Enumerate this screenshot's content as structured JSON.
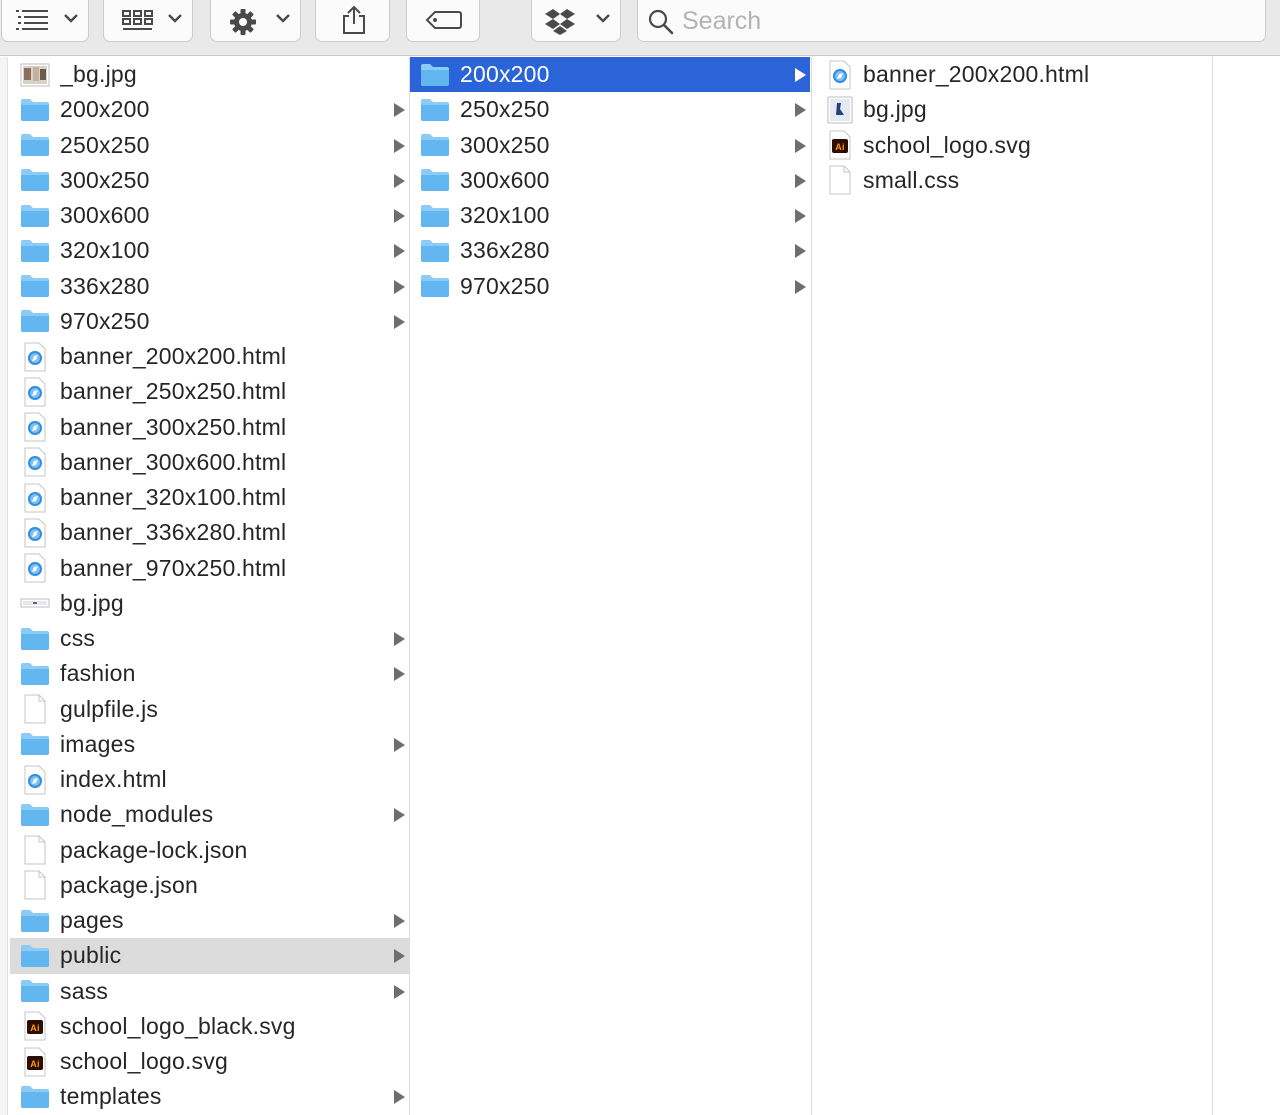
{
  "toolbar": {
    "search_placeholder": "Search",
    "search_value": ""
  },
  "colors": {
    "selection_blue": "#2b64d9",
    "selection_gray": "#dcdcdc",
    "folder_blue": "#62b7f0"
  },
  "column1": {
    "items": [
      {
        "name": "_bg.jpg",
        "type": "image-thumb",
        "folder": false
      },
      {
        "name": "200x200",
        "type": "folder",
        "folder": true
      },
      {
        "name": "250x250",
        "type": "folder",
        "folder": true
      },
      {
        "name": "300x250",
        "type": "folder",
        "folder": true
      },
      {
        "name": "300x600",
        "type": "folder",
        "folder": true
      },
      {
        "name": "320x100",
        "type": "folder",
        "folder": true
      },
      {
        "name": "336x280",
        "type": "folder",
        "folder": true
      },
      {
        "name": "970x250",
        "type": "folder",
        "folder": true
      },
      {
        "name": "banner_200x200.html",
        "type": "html",
        "folder": false
      },
      {
        "name": "banner_250x250.html",
        "type": "html",
        "folder": false
      },
      {
        "name": "banner_300x250.html",
        "type": "html",
        "folder": false
      },
      {
        "name": "banner_300x600.html",
        "type": "html",
        "folder": false
      },
      {
        "name": "banner_320x100.html",
        "type": "html",
        "folder": false
      },
      {
        "name": "banner_336x280.html",
        "type": "html",
        "folder": false
      },
      {
        "name": "banner_970x250.html",
        "type": "html",
        "folder": false
      },
      {
        "name": "bg.jpg",
        "type": "image-strip",
        "folder": false
      },
      {
        "name": "css",
        "type": "folder",
        "folder": true
      },
      {
        "name": "fashion",
        "type": "folder",
        "folder": true
      },
      {
        "name": "gulpfile.js",
        "type": "doc",
        "folder": false
      },
      {
        "name": "images",
        "type": "folder",
        "folder": true
      },
      {
        "name": "index.html",
        "type": "html",
        "folder": false
      },
      {
        "name": "node_modules",
        "type": "folder",
        "folder": true
      },
      {
        "name": "package-lock.json",
        "type": "doc",
        "folder": false
      },
      {
        "name": "package.json",
        "type": "doc",
        "folder": false
      },
      {
        "name": "pages",
        "type": "folder",
        "folder": true
      },
      {
        "name": "public",
        "type": "folder",
        "folder": true,
        "selected": "gray"
      },
      {
        "name": "sass",
        "type": "folder",
        "folder": true
      },
      {
        "name": "school_logo_black.svg",
        "type": "ai",
        "folder": false
      },
      {
        "name": "school_logo.svg",
        "type": "ai",
        "folder": false
      },
      {
        "name": "templates",
        "type": "folder",
        "folder": true
      }
    ]
  },
  "column2": {
    "items": [
      {
        "name": "200x200",
        "type": "folder",
        "folder": true,
        "selected": "blue"
      },
      {
        "name": "250x250",
        "type": "folder",
        "folder": true
      },
      {
        "name": "300x250",
        "type": "folder",
        "folder": true
      },
      {
        "name": "300x600",
        "type": "folder",
        "folder": true
      },
      {
        "name": "320x100",
        "type": "folder",
        "folder": true
      },
      {
        "name": "336x280",
        "type": "folder",
        "folder": true
      },
      {
        "name": "970x250",
        "type": "folder",
        "folder": true
      }
    ]
  },
  "column3": {
    "items": [
      {
        "name": "banner_200x200.html",
        "type": "html",
        "folder": false
      },
      {
        "name": "bg.jpg",
        "type": "image-blue",
        "folder": false
      },
      {
        "name": "school_logo.svg",
        "type": "ai",
        "folder": false
      },
      {
        "name": "small.css",
        "type": "doc",
        "folder": false
      }
    ]
  }
}
